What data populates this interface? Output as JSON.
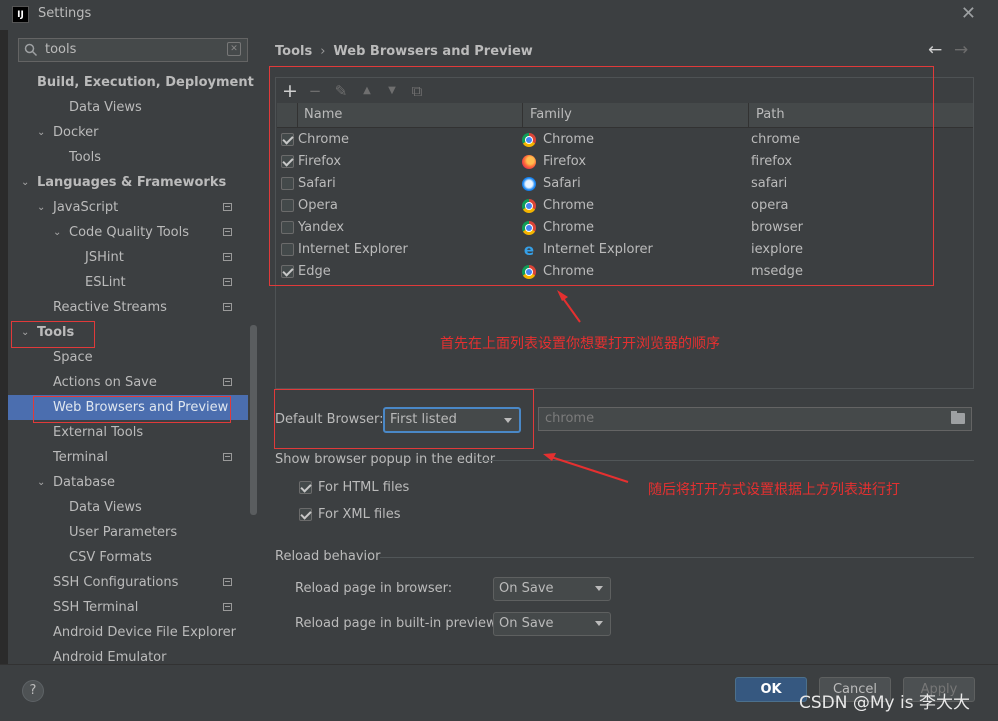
{
  "window": {
    "title": "Settings",
    "app_icon_text": "IJ"
  },
  "search": {
    "value": "tools"
  },
  "sidebar": {
    "items": [
      {
        "label": "Build, Execution, Deployment"
      },
      {
        "label": "Data Views"
      },
      {
        "label": "Docker"
      },
      {
        "label": "Tools"
      },
      {
        "label": "Languages & Frameworks"
      },
      {
        "label": "JavaScript"
      },
      {
        "label": "Code Quality Tools"
      },
      {
        "label": "JSHint"
      },
      {
        "label": "ESLint"
      },
      {
        "label": "Reactive Streams"
      },
      {
        "label": "Tools"
      },
      {
        "label": "Space"
      },
      {
        "label": "Actions on Save"
      },
      {
        "label": "Web Browsers and Preview"
      },
      {
        "label": "External Tools"
      },
      {
        "label": "Terminal"
      },
      {
        "label": "Database"
      },
      {
        "label": "Data Views"
      },
      {
        "label": "User Parameters"
      },
      {
        "label": "CSV Formats"
      },
      {
        "label": "SSH Configurations"
      },
      {
        "label": "SSH Terminal"
      },
      {
        "label": "Android Device File Explorer"
      },
      {
        "label": "Android Emulator"
      }
    ]
  },
  "breadcrumb": {
    "root": "Tools",
    "sep": "›",
    "current": "Web Browsers and Preview"
  },
  "toolbar": {
    "add": "+",
    "remove": "−",
    "edit": "✎",
    "up": "▲",
    "down": "▼",
    "copy": "⧉"
  },
  "table": {
    "headers": {
      "name": "Name",
      "family": "Family",
      "path": "Path"
    },
    "rows": [
      {
        "checked": true,
        "name": "Chrome",
        "family": "Chrome",
        "path": "chrome"
      },
      {
        "checked": true,
        "name": "Firefox",
        "family": "Firefox",
        "path": "firefox"
      },
      {
        "checked": false,
        "name": "Safari",
        "family": "Safari",
        "path": "safari"
      },
      {
        "checked": false,
        "name": "Opera",
        "family": "Chrome",
        "path": "opera"
      },
      {
        "checked": false,
        "name": "Yandex",
        "family": "Chrome",
        "path": "browser"
      },
      {
        "checked": false,
        "name": "Internet Explorer",
        "family": "Internet Explorer",
        "path": "iexplore"
      },
      {
        "checked": true,
        "name": "Edge",
        "family": "Chrome",
        "path": "msedge"
      }
    ]
  },
  "default_browser": {
    "label": "Default Browser:",
    "selected": "First listed",
    "path_value": "chrome"
  },
  "popup": {
    "section_title": "Show browser popup in the editor",
    "html_label": "For HTML files",
    "html_checked": true,
    "xml_label": "For XML files",
    "xml_checked": true
  },
  "reload": {
    "section_title": "Reload behavior",
    "browser_label": "Reload page in browser:",
    "browser_value": "On Save",
    "preview_label": "Reload page in built-in preview:",
    "preview_value": "On Save"
  },
  "annotations": {
    "note1": "首先在上面列表设置你想要打开浏览器的顺序",
    "note2": "随后将打开方式设置根据上方列表进行打",
    "color": "#e53030"
  },
  "buttons": {
    "help": "?",
    "ok": "OK",
    "cancel": "Cancel",
    "apply": "Apply"
  },
  "watermark": "CSDN @My is 李大大",
  "colors": {
    "selection": "#4b6eaf",
    "ok_button": "#365880",
    "background": "#3c3f41"
  }
}
